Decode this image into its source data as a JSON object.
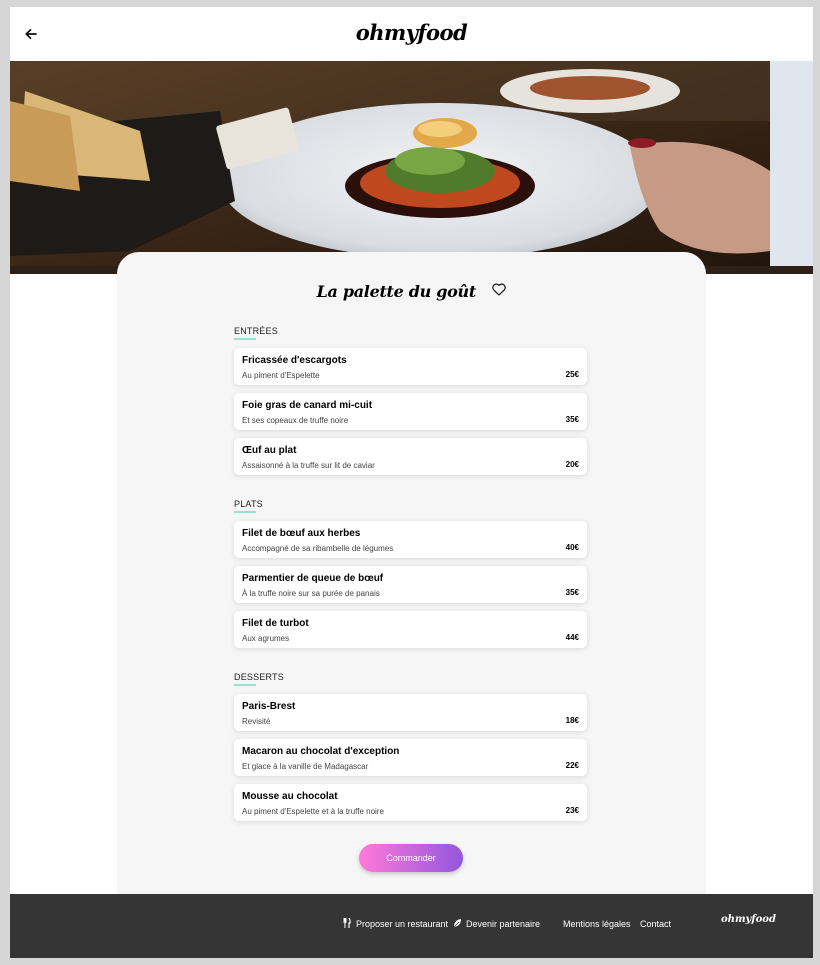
{
  "header": {
    "logo": "ohmyfood",
    "back_icon": "arrow-left-icon"
  },
  "restaurant": {
    "name": "La palette du goût",
    "favorite_icon": "heart-outline-icon"
  },
  "menu": {
    "sections": [
      {
        "title": "ENTRÉES",
        "items": [
          {
            "name": "Fricassée d'escargots",
            "description": "Au piment d'Espelette",
            "price": "25€"
          },
          {
            "name": "Foie gras de canard mi-cuit",
            "description": "Et ses copeaux de truffe noire",
            "price": "35€"
          },
          {
            "name": "Œuf au plat",
            "description": "Assaisonné à la truffe sur lit de caviar",
            "price": "20€"
          }
        ]
      },
      {
        "title": "PLATS",
        "items": [
          {
            "name": "Filet de bœuf aux herbes",
            "description": "Accompagné de sa ribambelle de légumes",
            "price": "40€"
          },
          {
            "name": "Parmentier de queue de bœuf",
            "description": "À la truffe noire sur sa purée de panais",
            "price": "35€"
          },
          {
            "name": "Filet de turbot",
            "description": "Aux agrumes",
            "price": "44€"
          }
        ]
      },
      {
        "title": "DESSERTS",
        "items": [
          {
            "name": "Paris-Brest",
            "description": "Revisité",
            "price": "18€"
          },
          {
            "name": "Macaron au chocolat d'exception",
            "description": "Et glace à la vanille de Madagascar",
            "price": "22€"
          },
          {
            "name": "Mousse au chocolat",
            "description": "Au piment d'Espelette et à la truffe noire",
            "price": "23€"
          }
        ]
      }
    ]
  },
  "order_button": "Commander",
  "footer": {
    "propose_restaurant": "Proposer un restaurant",
    "propose_icon": "fork-knife-icon",
    "become_partner": "Devenir partenaire",
    "partner_icon": "leaf-icon",
    "legal": "Mentions légales",
    "contact": "Contact",
    "logo": "ohmyfood"
  },
  "colors": {
    "accent_line": "#99e2d0",
    "button_gradient_start": "#ff79da",
    "button_gradient_end": "#9356dc",
    "footer_bg": "#353535"
  }
}
